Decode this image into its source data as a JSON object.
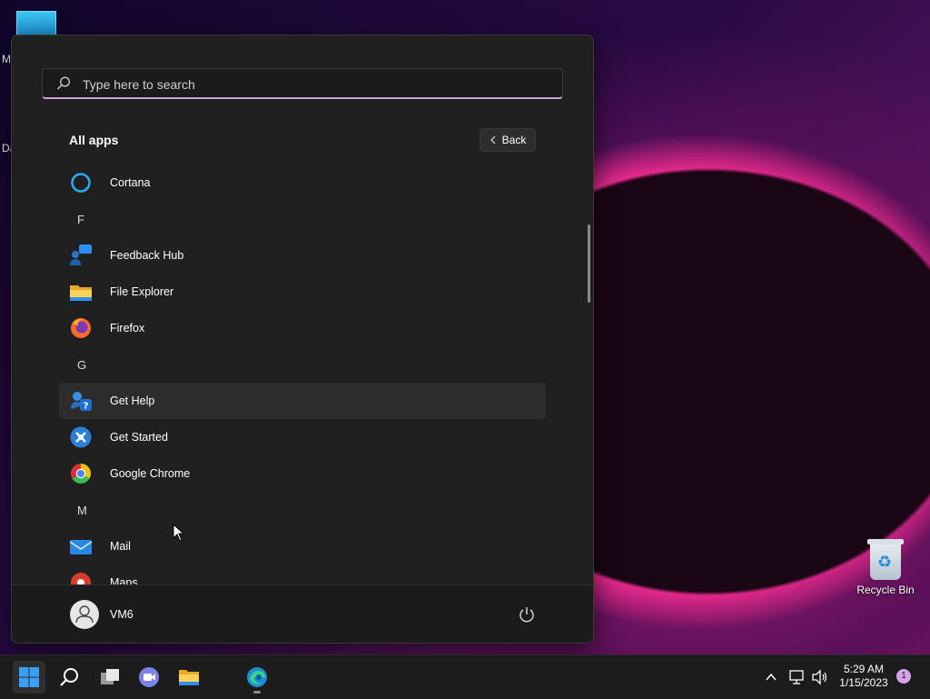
{
  "desktop": {
    "fragments": [
      "M",
      "Da"
    ],
    "recycle_bin": "Recycle Bin"
  },
  "start_menu": {
    "search": {
      "placeholder": "Type here to search",
      "value": ""
    },
    "title": "All apps",
    "back_label": "Back",
    "items": [
      {
        "kind": "app",
        "label": "Cortana",
        "icon": "cortana-icon"
      },
      {
        "kind": "letter",
        "label": "F"
      },
      {
        "kind": "app",
        "label": "Feedback Hub",
        "icon": "feedback-hub-icon"
      },
      {
        "kind": "app",
        "label": "File Explorer",
        "icon": "file-explorer-icon"
      },
      {
        "kind": "app",
        "label": "Firefox",
        "icon": "firefox-icon"
      },
      {
        "kind": "letter",
        "label": "G"
      },
      {
        "kind": "app",
        "label": "Get Help",
        "icon": "get-help-icon",
        "hovered": true
      },
      {
        "kind": "app",
        "label": "Get Started",
        "icon": "get-started-icon"
      },
      {
        "kind": "app",
        "label": "Google Chrome",
        "icon": "chrome-icon"
      },
      {
        "kind": "letter",
        "label": "M"
      },
      {
        "kind": "app",
        "label": "Mail",
        "icon": "mail-icon"
      },
      {
        "kind": "app",
        "label": "Maps",
        "icon": "maps-icon"
      }
    ],
    "user": {
      "name": "VM6"
    }
  },
  "taskbar": {
    "apps": [
      "start-icon",
      "search-icon",
      "task-view-icon",
      "teams-chat-icon",
      "file-explorer-icon",
      "edge-icon"
    ],
    "clock": {
      "time": "5:29 AM",
      "date": "1/15/2023"
    },
    "notification_count": "1"
  },
  "colors": {
    "menu_bg": "#202020",
    "accent": "#c9a3d6",
    "taskbar_bg": "#1c1c1c"
  }
}
